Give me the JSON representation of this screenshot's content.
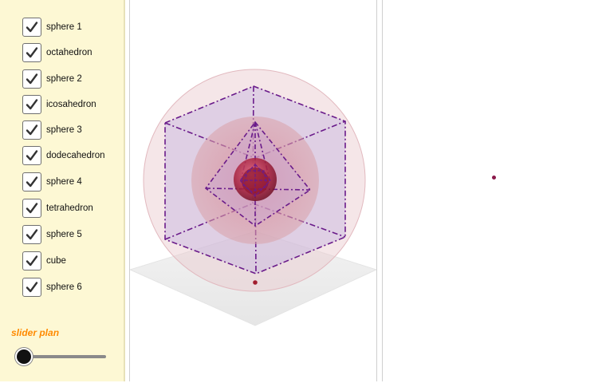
{
  "checkboxes": [
    {
      "label": "sphere 1",
      "checked": true
    },
    {
      "label": "octahedron",
      "checked": true
    },
    {
      "label": "sphere 2",
      "checked": true
    },
    {
      "label": "icosahedron",
      "checked": true
    },
    {
      "label": "sphere 3",
      "checked": true
    },
    {
      "label": "dodecahedron",
      "checked": true
    },
    {
      "label": "sphere 4",
      "checked": true
    },
    {
      "label": "tetrahedron",
      "checked": true
    },
    {
      "label": "sphere 5",
      "checked": true
    },
    {
      "label": "cube",
      "checked": true
    },
    {
      "label": "sphere 6",
      "checked": true
    }
  ],
  "slider": {
    "label": "slider plan",
    "value_fraction": 0.0
  },
  "colors": {
    "sidebar_bg": "#fdf8d4",
    "checkmark": "#333333",
    "slider_label": "#ff8a00",
    "polyhedron_edges": "#6a1b8a",
    "sphere_fill": "#c0394b",
    "point": "#8b1a4a"
  },
  "icons": {
    "checkbox": "checkmark-icon"
  }
}
